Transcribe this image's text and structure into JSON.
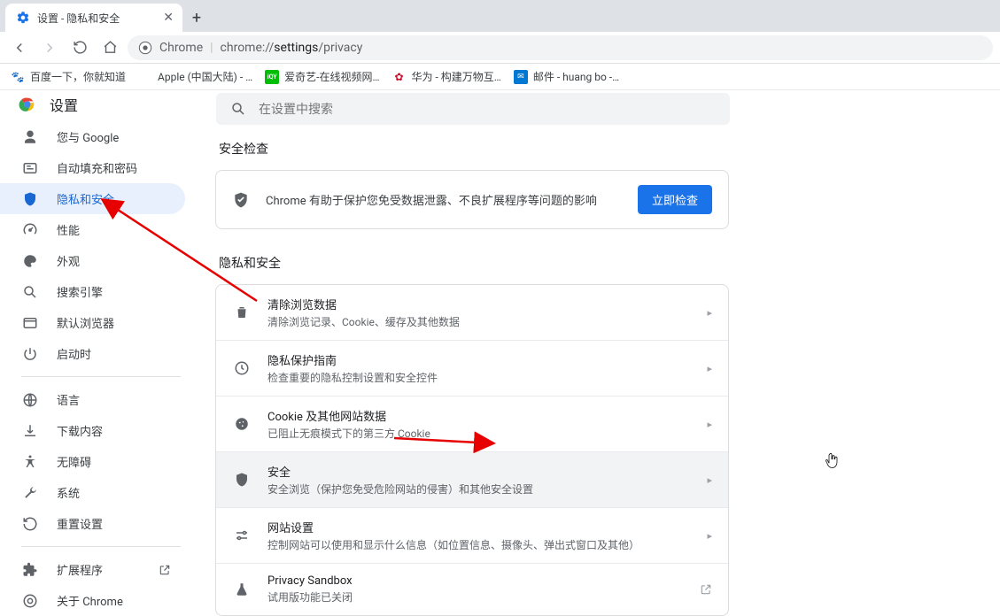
{
  "browser": {
    "tab_title": "设置 - 隐私和安全",
    "url_host": "Chrome",
    "url_path_highlight": "settings",
    "url_path_full": "chrome://settings/privacy"
  },
  "bookmarks": [
    {
      "label": "百度一下，你就知道",
      "icon_color": "#2932e1"
    },
    {
      "label": "Apple (中国大陆) - …",
      "icon_char": ""
    },
    {
      "label": "爱奇艺-在线视频网…",
      "icon_color": "#00be06",
      "icon_char": "iQY"
    },
    {
      "label": "华为 - 构建万物互…",
      "icon_color": "#cf0a2c",
      "icon_char": "✿"
    },
    {
      "label": "邮件 - huang bo -…",
      "icon_color": "#0078d4",
      "icon_char": "✉"
    }
  ],
  "settings": {
    "title": "设置",
    "search_placeholder": "在设置中搜索"
  },
  "sidebar": {
    "items": [
      {
        "label": "您与 Google"
      },
      {
        "label": "自动填充和密码"
      },
      {
        "label": "隐私和安全"
      },
      {
        "label": "性能"
      },
      {
        "label": "外观"
      },
      {
        "label": "搜索引擎"
      },
      {
        "label": "默认浏览器"
      },
      {
        "label": "启动时"
      }
    ],
    "secondary": [
      {
        "label": "语言"
      },
      {
        "label": "下载内容"
      },
      {
        "label": "无障碍"
      },
      {
        "label": "系统"
      },
      {
        "label": "重置设置"
      }
    ],
    "footer": [
      {
        "label": "扩展程序",
        "external": true
      },
      {
        "label": "关于 Chrome"
      }
    ]
  },
  "sections": {
    "safety_title": "安全检查",
    "safety_desc": "Chrome 有助于保护您免受数据泄露、不良扩展程序等问题的影响",
    "safety_button": "立即检查",
    "privacy_title": "隐私和安全",
    "rows": [
      {
        "title": "清除浏览数据",
        "sub": "清除浏览记录、Cookie、缓存及其他数据"
      },
      {
        "title": "隐私保护指南",
        "sub": "检查重要的隐私控制设置和安全控件"
      },
      {
        "title": "Cookie 及其他网站数据",
        "sub": "已阻止无痕模式下的第三方 Cookie"
      },
      {
        "title": "安全",
        "sub": "安全浏览（保护您免受危险网站的侵害）和其他安全设置"
      },
      {
        "title": "网站设置",
        "sub": "控制网站可以使用和显示什么信息（如位置信息、摄像头、弹出式窗口及其他）"
      },
      {
        "title": "Privacy Sandbox",
        "sub": "试用版功能已关闭"
      }
    ]
  }
}
